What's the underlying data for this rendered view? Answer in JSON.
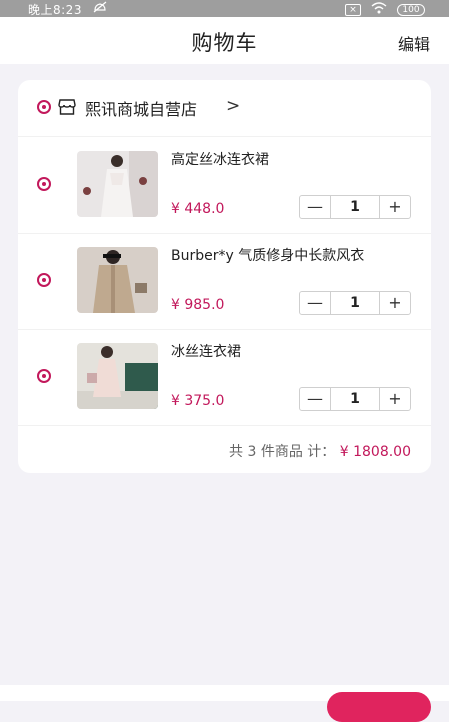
{
  "status_bar": {
    "time": "晚上8:23",
    "battery": "100"
  },
  "header": {
    "title": "购物车",
    "edit_label": "编辑"
  },
  "store": {
    "name": "熙讯商城自营店",
    "arrow": ">"
  },
  "items": [
    {
      "name": "高定丝冰连衣裙",
      "price": "¥ 448.0",
      "quantity": "1"
    },
    {
      "name": "Burber*y 气质修身中长款风衣",
      "price": "¥ 985.0",
      "quantity": "1"
    },
    {
      "name": "冰丝连衣裙",
      "price": "¥ 375.0",
      "quantity": "1"
    }
  ],
  "stepper": {
    "minus": "—",
    "plus": "+"
  },
  "summary": {
    "count_text": "共 3 件商品 计：",
    "total": "¥ 1808.00"
  },
  "colors": {
    "accent": "#c2185b",
    "button": "#e0245e"
  }
}
